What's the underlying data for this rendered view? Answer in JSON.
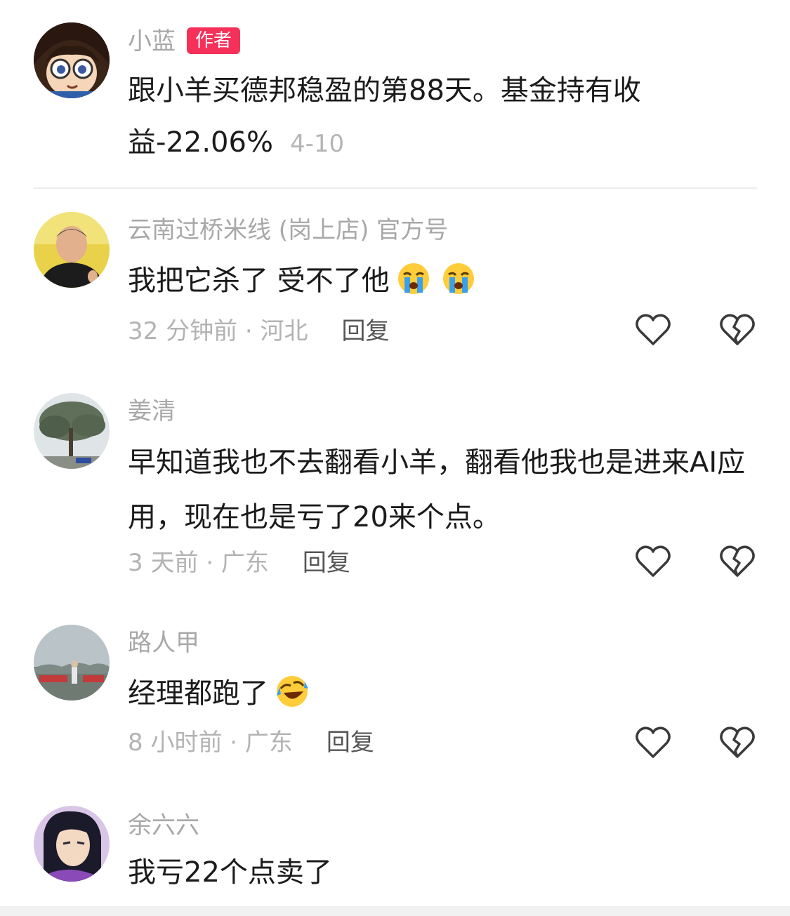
{
  "comments": [
    {
      "username": "小蓝",
      "badge": "作者",
      "text_line1": "跟小羊买德邦稳盈的第88天。基金持有收",
      "text_line2": "益-22.06%",
      "date": "4-10"
    },
    {
      "username": "云南过桥米线 (岗上店) 官方号",
      "text": "我把它杀了 受不了他",
      "meta": "32 分钟前 · 河北",
      "reply": "回复"
    },
    {
      "username": "姜清",
      "text": "早知道我也不去翻看小羊，翻看他我也是进来AI应用，现在也是亏了20来个点。",
      "meta": "3 天前 · 广东",
      "reply": "回复"
    },
    {
      "username": "路人甲",
      "text": "经理都跑了",
      "meta": "8 小时前 · 广东",
      "reply": "回复"
    },
    {
      "username": "余六六",
      "text": "我亏22个点卖了"
    }
  ],
  "icons": {
    "like": "heart-outline-icon",
    "dislike": "broken-heart-icon",
    "crying_emoji": "loudly-crying-face-icon",
    "laughing_emoji": "rolling-laughing-face-icon"
  },
  "colors": {
    "badge": "#f5315a",
    "username": "#a8a8a8",
    "meta": "#b3b3b3",
    "reply": "#555555"
  }
}
